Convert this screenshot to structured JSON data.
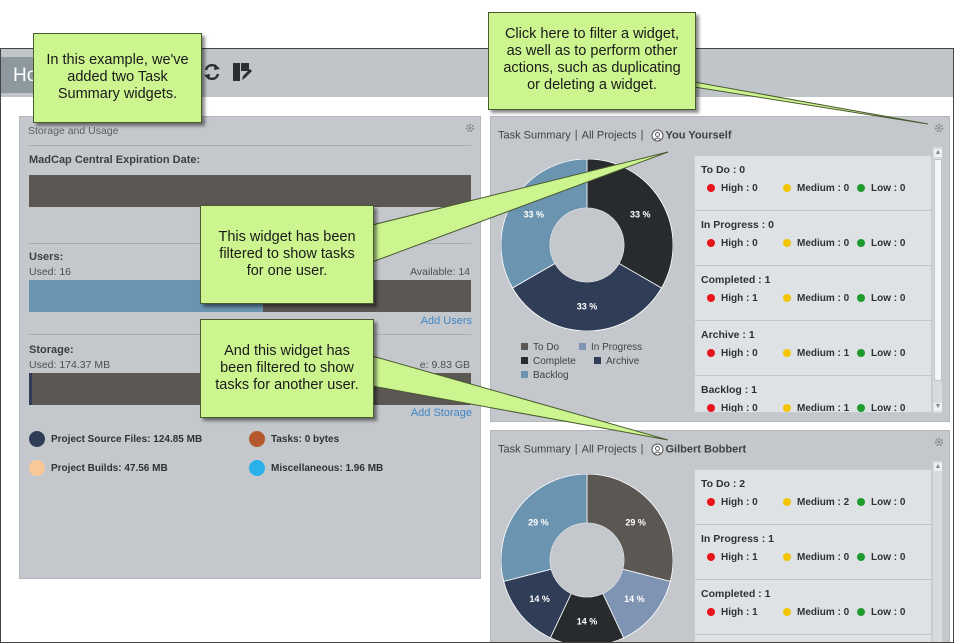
{
  "toolbar": {
    "home_label": "Ho",
    "refresh_icon": "refresh-icon",
    "widget_icon": "add-widget-icon"
  },
  "storage_widget": {
    "title": "Storage and Usage",
    "expiration_label": "MadCap Central Expiration Date:",
    "users_label": "Users:",
    "users_used": "Used: 16",
    "users_available": "Available: 14",
    "users_used_fraction": 0.53,
    "add_users": "Add Users",
    "storage_label": "Storage:",
    "storage_used": "Used: 174.37 MB",
    "storage_available": "e: 9.83 GB",
    "add_storage": "Add Storage",
    "legend": [
      {
        "label": "Project Source Files: 124.85 MB",
        "color": "#2f3d57"
      },
      {
        "label": "Tasks: 0 bytes",
        "color": "#b5582d"
      },
      {
        "label": "Project Builds: 47.56 MB",
        "color": "#f7c89a"
      },
      {
        "label": "Miscellaneous: 1.96 MB",
        "color": "#2bb1ea"
      }
    ]
  },
  "task_widget_1": {
    "title": "Task Summary",
    "scope": "All Projects",
    "user": "You Yourself",
    "chart_data": {
      "type": "pie",
      "categories": [
        "To Do",
        "In Progress",
        "Complete",
        "Archive",
        "Backlog"
      ],
      "values": [
        0,
        0,
        33,
        33,
        33
      ],
      "labels": [
        "33 %",
        "33 %",
        "33 %"
      ],
      "colors": [
        "#5b5753",
        "#7f93b2",
        "#282b2e",
        "#2f3d57",
        "#6a94b0"
      ]
    },
    "legend": [
      {
        "label": "To Do",
        "color": "#5b5753"
      },
      {
        "label": "In Progress",
        "color": "#7f93b2"
      },
      {
        "label": "Complete",
        "color": "#282b2e"
      },
      {
        "label": "Archive",
        "color": "#2f3d57"
      },
      {
        "label": "Backlog",
        "color": "#6a94b0"
      }
    ],
    "statuses": [
      {
        "name": "To Do : 0",
        "high": "High : 0",
        "medium": "Medium : 0",
        "low": "Low : 0"
      },
      {
        "name": "In Progress : 0",
        "high": "High : 0",
        "medium": "Medium : 0",
        "low": "Low : 0"
      },
      {
        "name": "Completed : 1",
        "high": "High : 1",
        "medium": "Medium : 0",
        "low": "Low : 0"
      },
      {
        "name": "Archive : 1",
        "high": "High : 0",
        "medium": "Medium : 1",
        "low": "Low : 0"
      },
      {
        "name": "Backlog : 1",
        "high": "High : 0",
        "medium": "Medium : 1",
        "low": "Low : 0"
      }
    ]
  },
  "task_widget_2": {
    "title": "Task Summary",
    "scope": "All Projects",
    "user": "Gilbert Bobbert",
    "chart_data": {
      "type": "pie",
      "categories": [
        "To Do",
        "In Progress",
        "Complete",
        "Archive",
        "Backlog"
      ],
      "values": [
        29,
        14,
        14,
        14,
        29
      ],
      "labels": [
        "29 %",
        "14 %",
        "14 %",
        "14 %",
        "29 %"
      ],
      "colors": [
        "#5b5753",
        "#7f93b2",
        "#282b2e",
        "#2f3d57",
        "#6a94b0"
      ]
    },
    "statuses": [
      {
        "name": "To Do : 2",
        "high": "High : 0",
        "medium": "Medium : 2",
        "low": "Low : 0"
      },
      {
        "name": "In Progress : 1",
        "high": "High : 1",
        "medium": "Medium : 0",
        "low": "Low : 0"
      },
      {
        "name": "Completed : 1",
        "high": "High : 1",
        "medium": "Medium : 0",
        "low": "Low : 0"
      }
    ]
  },
  "priority_colors": {
    "high": "#e8141c",
    "medium": "#f5c400",
    "low": "#1f9a2c"
  },
  "callouts": {
    "example": [
      "In this example, we've",
      "added two Task",
      "Summary widgets."
    ],
    "filter": [
      "Click here to filter a widget,",
      "as well as to perform other",
      "actions, such as duplicating",
      "or deleting a widget."
    ],
    "one_user": [
      "This widget has been",
      "filtered to show tasks",
      "for one user."
    ],
    "another_user": [
      "And this widget has",
      "been filtered to show",
      "tasks for another user."
    ]
  }
}
